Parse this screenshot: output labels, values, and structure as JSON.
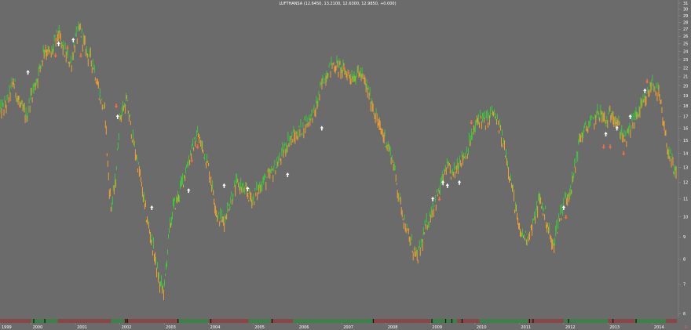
{
  "chart_data": {
    "type": "line",
    "title": "LUFTHANSA (12.6450, 13.2100, 12.6300, 12.9850, +0.000)",
    "y_scale": "log",
    "ylim": [
      6,
      31
    ],
    "xlim": [
      1999.3,
      2014.55
    ],
    "y_ticks": [
      "31",
      "30",
      "29",
      "28",
      "27",
      "26",
      "25",
      "24",
      "23",
      "22",
      "21",
      "20",
      "19",
      "18",
      "17",
      "16",
      "15",
      "14",
      "13",
      "12",
      "11",
      "10",
      "9",
      "8",
      "7",
      "6"
    ],
    "y_tick_values": [
      31,
      30,
      29,
      28,
      27,
      26,
      25,
      24,
      23,
      22,
      21,
      20,
      19,
      18,
      17,
      16,
      15,
      14,
      13,
      12,
      11,
      10,
      9,
      8,
      7,
      6
    ],
    "x_tick_labels": [
      "1999",
      "2000",
      "2001",
      "2002",
      "2003",
      "2004",
      "2005",
      "2006",
      "2007",
      "2008",
      "2009",
      "2010",
      "2011",
      "2012",
      "2013",
      "2014"
    ],
    "x_tick_positions": [
      1999.3,
      2000,
      2001,
      2002,
      2003,
      2004,
      2005,
      2006,
      2007,
      2008,
      2009,
      2010,
      2011,
      2012,
      2013,
      2014
    ],
    "corner_label": "0",
    "colors": {
      "background": "#6b6b6b",
      "up": "#3cc83c",
      "down": "#f0a030",
      "arrow_up": "#ffffff",
      "arrow_down": "#f07040",
      "regime_up": "#3f7f4a",
      "regime_down": "#8a4548"
    },
    "series": [
      {
        "x": [
          1999.3,
          1999.45,
          1999.6,
          1999.75,
          1999.9,
          2000.0,
          2000.15,
          2000.3,
          2000.45,
          2000.6,
          2000.75,
          2000.9,
          2001.0,
          2001.1,
          2001.25,
          2001.4,
          2001.55,
          2001.68,
          2001.72,
          2001.8,
          2001.9,
          2002.0,
          2002.15,
          2002.3,
          2002.45,
          2002.6,
          2002.75,
          2002.9,
          2003.0,
          2003.1,
          2003.2,
          2003.3,
          2003.45,
          2003.6,
          2003.75,
          2003.9,
          2004.0,
          2004.1,
          2004.2,
          2004.35,
          2004.5,
          2004.65,
          2004.8,
          2005.0,
          2005.2,
          2005.4,
          2005.6,
          2005.8,
          2006.0,
          2006.2,
          2006.4,
          2006.6,
          2006.8,
          2006.95,
          2007.1,
          2007.25,
          2007.4,
          2007.55,
          2007.7,
          2007.85,
          2008.0,
          2008.15,
          2008.3,
          2008.5,
          2008.7,
          2008.9,
          2009.05,
          2009.2,
          2009.35,
          2009.5,
          2009.65,
          2009.8,
          2009.95,
          2010.1,
          2010.25,
          2010.4,
          2010.55,
          2010.7,
          2010.85,
          2011.0,
          2011.15,
          2011.3,
          2011.45,
          2011.6,
          2011.75,
          2011.9,
          2012.05,
          2012.2,
          2012.35,
          2012.5,
          2012.65,
          2012.8,
          2012.95,
          2013.1,
          2013.25,
          2013.4,
          2013.55,
          2013.7,
          2013.85,
          2014.0,
          2014.15,
          2014.3,
          2014.42,
          2014.5,
          2014.55
        ],
        "y": [
          17.5,
          18.2,
          20.5,
          18,
          17,
          19,
          21,
          24.5,
          23.5,
          26.5,
          24,
          22.5,
          25.5,
          27,
          24,
          22.5,
          19,
          17,
          13.5,
          10.5,
          12,
          17,
          18.5,
          15,
          12.5,
          10,
          8.5,
          7,
          6.8,
          9,
          10.5,
          11,
          12.5,
          14,
          15.5,
          14,
          13,
          11.5,
          10,
          9.8,
          11,
          12,
          11.5,
          11,
          12,
          12.5,
          13.5,
          15,
          15.5,
          16.5,
          17.5,
          21,
          22.5,
          22,
          21.5,
          21,
          21.5,
          20,
          18,
          16,
          15,
          13.5,
          11,
          9,
          8,
          9.5,
          10.5,
          11.5,
          13,
          12.5,
          13.5,
          14,
          15.5,
          17,
          16.5,
          17.5,
          16,
          14,
          11.5,
          9.2,
          9,
          9.5,
          11,
          10,
          8.5,
          10,
          11,
          12,
          15,
          16,
          16.5,
          17.5,
          16.5,
          17.5,
          16,
          15,
          16.5,
          17.5,
          18.5,
          20.5,
          19,
          15,
          13.5,
          12.5,
          12.5
        ]
      }
    ],
    "buy_signals": [
      {
        "x": 1999.93,
        "y": 21.5
      },
      {
        "x": 2000.62,
        "y": 25.0
      },
      {
        "x": 2000.95,
        "y": 25.5
      },
      {
        "x": 2001.95,
        "y": 17.0
      },
      {
        "x": 2002.72,
        "y": 10.5
      },
      {
        "x": 2003.55,
        "y": 11.5
      },
      {
        "x": 2004.35,
        "y": 11.8
      },
      {
        "x": 2004.88,
        "y": 11.6
      },
      {
        "x": 2005.78,
        "y": 12.5
      },
      {
        "x": 2006.55,
        "y": 16.0
      },
      {
        "x": 2009.05,
        "y": 11.0
      },
      {
        "x": 2009.28,
        "y": 12.0
      },
      {
        "x": 2009.38,
        "y": 11.8
      },
      {
        "x": 2009.65,
        "y": 12.0
      },
      {
        "x": 2012.0,
        "y": 10.5
      },
      {
        "x": 2012.95,
        "y": 15.5
      },
      {
        "x": 2013.2,
        "y": 16.0
      },
      {
        "x": 2013.5,
        "y": 17.0
      },
      {
        "x": 2013.83,
        "y": 19.5
      }
    ],
    "sell_signals": [
      {
        "x": 2000.55,
        "y": 23.5
      },
      {
        "x": 2000.82,
        "y": 24.5
      },
      {
        "x": 2001.12,
        "y": 23.5
      },
      {
        "x": 2001.92,
        "y": 18.0
      },
      {
        "x": 2003.62,
        "y": 13.5
      },
      {
        "x": 2003.75,
        "y": 14.5
      },
      {
        "x": 2007.05,
        "y": 22.0
      },
      {
        "x": 2007.15,
        "y": 21.5
      },
      {
        "x": 2009.2,
        "y": 11.0
      },
      {
        "x": 2009.92,
        "y": 16.5
      },
      {
        "x": 2012.05,
        "y": 10.0
      },
      {
        "x": 2012.9,
        "y": 14.5
      },
      {
        "x": 2013.05,
        "y": 14.5
      },
      {
        "x": 2013.35,
        "y": 14.0
      },
      {
        "x": 2013.88,
        "y": 20.5
      }
    ],
    "regime": [
      {
        "from": 1999.3,
        "to": 2000.0,
        "state": "down"
      },
      {
        "from": 2000.0,
        "to": 2000.6,
        "state": "up"
      },
      {
        "from": 2000.6,
        "to": 2001.8,
        "state": "down"
      },
      {
        "from": 2001.8,
        "to": 2002.1,
        "state": "up"
      },
      {
        "from": 2002.1,
        "to": 2003.3,
        "state": "down"
      },
      {
        "from": 2003.3,
        "to": 2004.0,
        "state": "up"
      },
      {
        "from": 2004.0,
        "to": 2004.9,
        "state": "down"
      },
      {
        "from": 2004.9,
        "to": 2005.4,
        "state": "up"
      },
      {
        "from": 2005.4,
        "to": 2005.9,
        "state": "down"
      },
      {
        "from": 2005.9,
        "to": 2007.7,
        "state": "up"
      },
      {
        "from": 2007.7,
        "to": 2009.0,
        "state": "down"
      },
      {
        "from": 2009.0,
        "to": 2009.6,
        "state": "up"
      },
      {
        "from": 2009.6,
        "to": 2010.1,
        "state": "down"
      },
      {
        "from": 2010.1,
        "to": 2011.2,
        "state": "up"
      },
      {
        "from": 2011.2,
        "to": 2012.0,
        "state": "down"
      },
      {
        "from": 2012.0,
        "to": 2013.0,
        "state": "up"
      },
      {
        "from": 2013.0,
        "to": 2013.6,
        "state": "down"
      },
      {
        "from": 2013.6,
        "to": 2014.3,
        "state": "up"
      },
      {
        "from": 2014.3,
        "to": 2014.55,
        "state": "down"
      }
    ],
    "regime_markers": [
      2000.05,
      2000.3,
      2002.12,
      2002.16,
      2003.3,
      2004.04,
      2005.42,
      2007.7,
      2009.02,
      2009.33,
      2009.47,
      2009.7,
      2011.22,
      2011.3,
      2012.1,
      2013.1,
      2013.62
    ]
  }
}
